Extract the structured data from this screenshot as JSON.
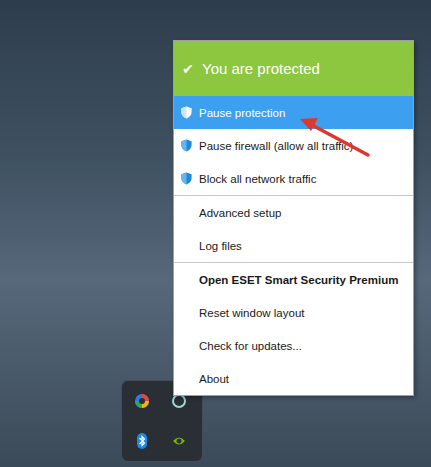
{
  "menu": {
    "header": {
      "icon": "✔",
      "text": "You are protected"
    },
    "groups": [
      [
        {
          "label": "Pause protection",
          "kind": "shield",
          "bold": false,
          "selected": true
        },
        {
          "label": "Pause firewall (allow all traffic)",
          "kind": "shield",
          "bold": false,
          "selected": false
        },
        {
          "label": "Block all network traffic",
          "kind": "shield",
          "bold": false,
          "selected": false
        }
      ],
      [
        {
          "label": "Advanced setup",
          "kind": "plain",
          "bold": false,
          "selected": false
        },
        {
          "label": "Log files",
          "kind": "plain",
          "bold": false,
          "selected": false
        }
      ],
      [
        {
          "label": "Open ESET Smart Security Premium",
          "kind": "plain",
          "bold": true,
          "selected": false
        },
        {
          "label": "Reset window layout",
          "kind": "plain",
          "bold": false,
          "selected": false
        },
        {
          "label": "Check for updates...",
          "kind": "plain",
          "bold": false,
          "selected": false
        },
        {
          "label": "About",
          "kind": "plain",
          "bold": false,
          "selected": false
        }
      ]
    ]
  }
}
